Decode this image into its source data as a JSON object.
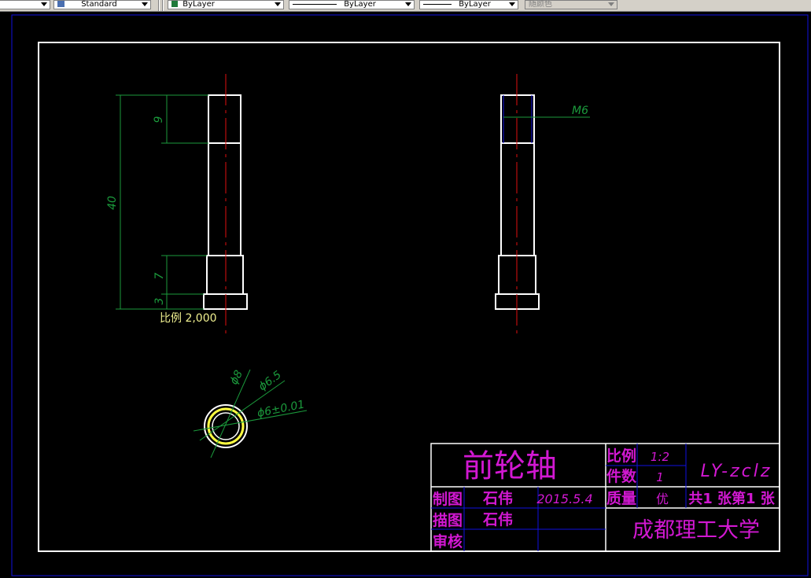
{
  "toolbar": {
    "text_style": "Standard",
    "layer_color": "ByLayer",
    "linetype": "ByLayer",
    "lineweight": "ByLayer",
    "plot_style": "随颜色",
    "colors": {
      "layer_swatch": "#1f7a3a",
      "face": "#d4d0c8"
    }
  },
  "drawing": {
    "colors": {
      "background": "#000000",
      "outline": "#ffffff",
      "center_line": "#e01010",
      "dimension": "#1b9a3c",
      "title_text": "#d218d2",
      "title_grid": "#1010e0",
      "highlight": "#ffff40",
      "scale_label": "#f0f090"
    },
    "dimensions": {
      "d9": "9",
      "d40": "40",
      "d7": "7",
      "d3": "3",
      "m6": "M6",
      "phi8": "ϕ8",
      "phi65": "ϕ6.5",
      "phi6": "ϕ6±0.01"
    },
    "scale_note": "比例 2,000"
  },
  "title_block": {
    "part_name": "前轮轴",
    "scale_label": "比例",
    "scale_value": "1:2",
    "count_label": "件数",
    "count_value": "1",
    "drawing_no": "LY-zclz",
    "drawn_label": "制图",
    "drawn_by": "石伟",
    "date": "2015.5.4",
    "quality_label": "质量",
    "quality_value": "优",
    "sheet_info": "共1 张第1 张",
    "traced_label": "描图",
    "traced_by": "石伟",
    "checked_label": "审核",
    "institution": "成都理工大学"
  }
}
